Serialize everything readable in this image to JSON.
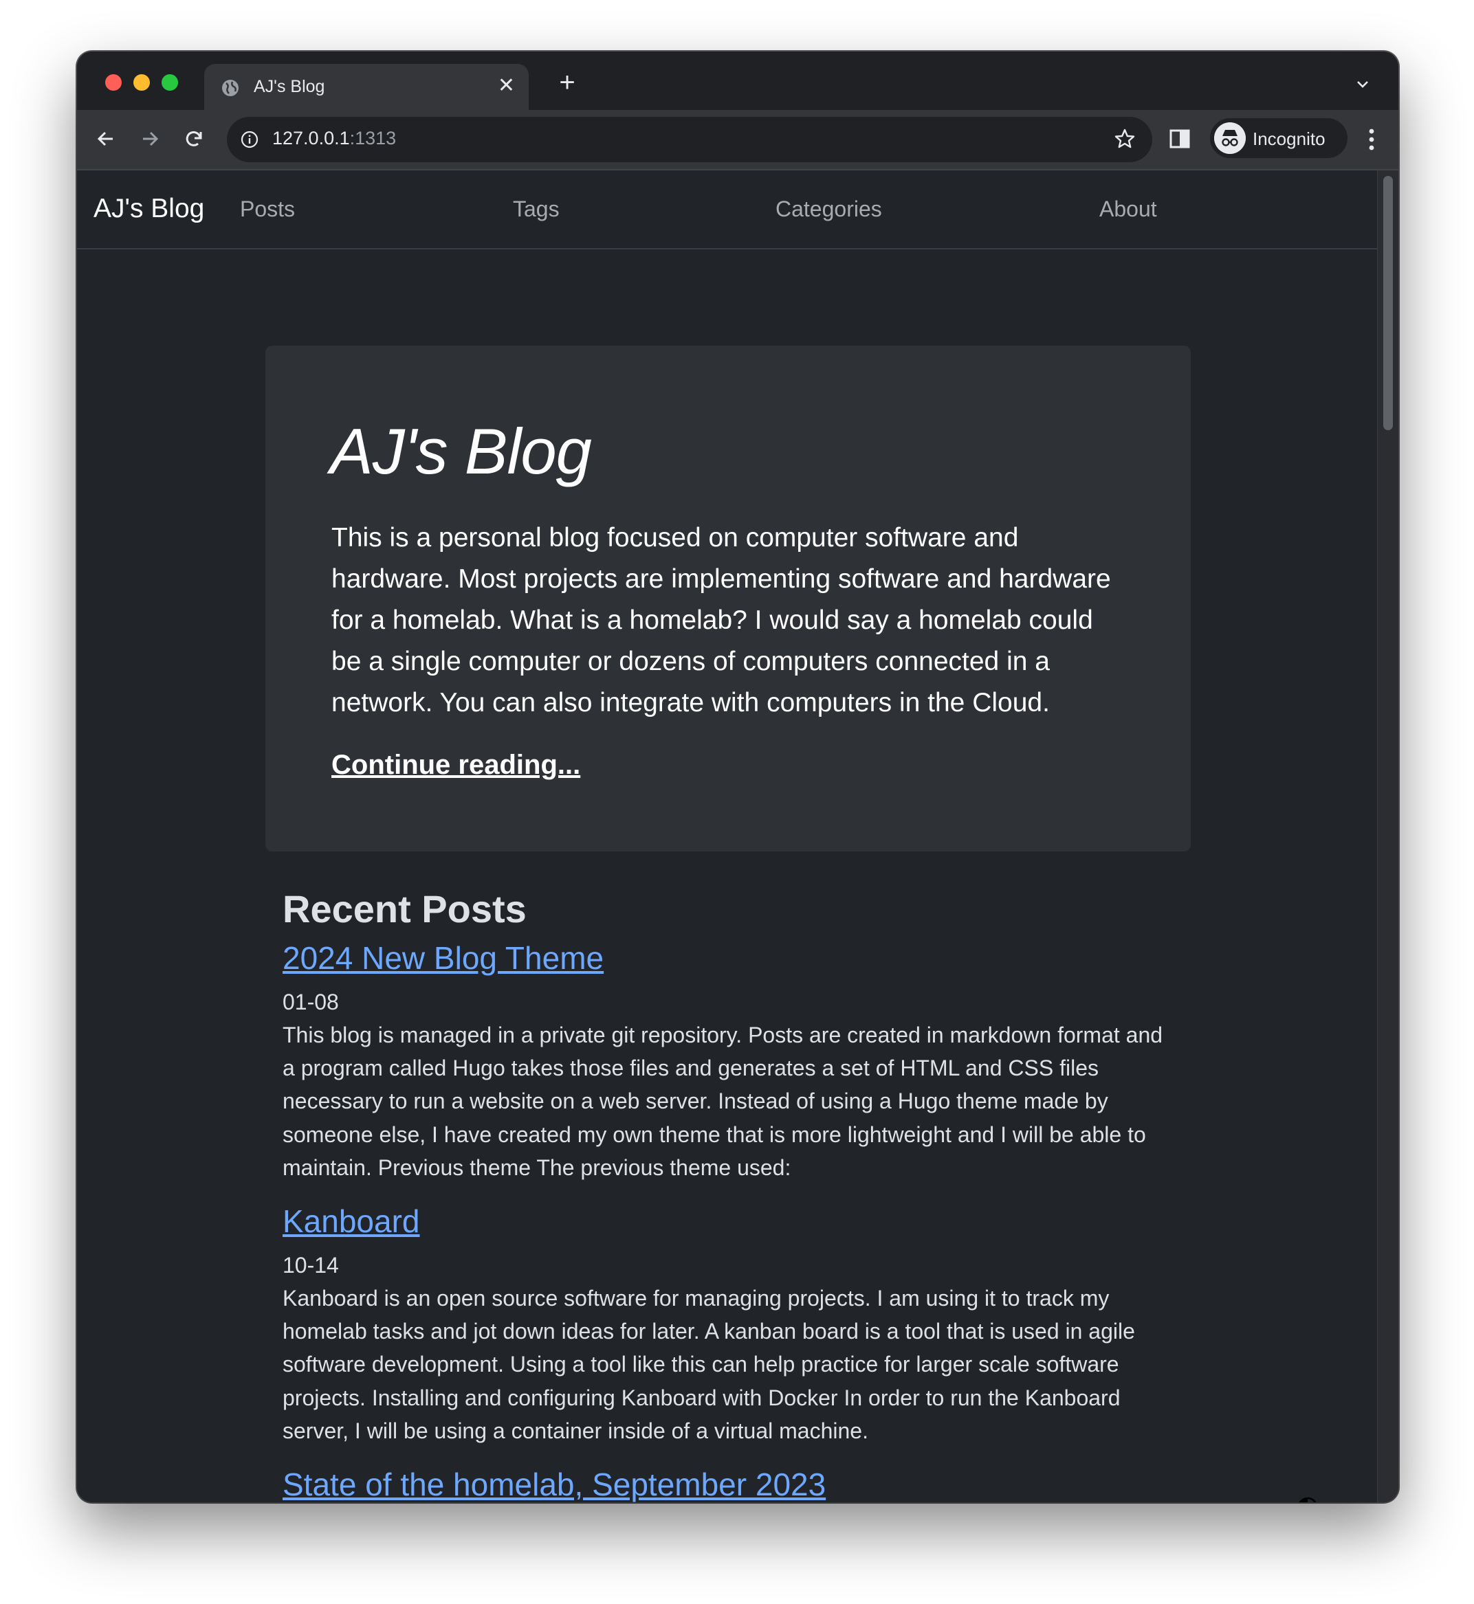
{
  "browser": {
    "tab_title": "AJ's Blog",
    "tab_close": "✕",
    "new_tab": "+",
    "url_host": "127.0.0.1",
    "url_port": ":1313",
    "incognito_label": "Incognito"
  },
  "navbar": {
    "brand": "AJ's Blog",
    "links": [
      "Posts",
      "Tags",
      "Categories",
      "About"
    ]
  },
  "jumbotron": {
    "title": "AJ's Blog",
    "lead": "This is a personal blog focused on computer software and hardware. Most projects are implementing software and hardware for a homelab. What is a homelab? I would say a homelab could be a single computer or dozens of computers connected in a network. You can also integrate with computers in the Cloud.",
    "link": "Continue reading..."
  },
  "recent_posts": {
    "heading": "Recent Posts",
    "posts": [
      {
        "title": "2024 New Blog Theme",
        "date": "01-08",
        "summary": "This blog is managed in a private git repository. Posts are created in markdown format and a program called Hugo takes those files and generates a set of HTML and CSS files necessary to run a website on a web server. Instead of using a Hugo theme made by someone else, I have created my own theme that is more lightweight and I will be able to maintain. Previous theme The previous theme used:"
      },
      {
        "title": "Kanboard",
        "date": "10-14",
        "summary": "Kanboard is an open source software for managing projects. I am using it to track my homelab tasks and jot down ideas for later. A kanban board is a tool that is used in agile software development. Using a tool like this can help practice for larger scale software projects. Installing and configuring Kanboard with Docker In order to run the Kanboard server, I will be using a container inside of a virtual machine."
      },
      {
        "title": "State of the homelab, September 2023",
        "date": "",
        "summary": ""
      }
    ]
  },
  "icons": {
    "tab": "globe-icon",
    "back": "arrow-left-icon",
    "forward": "arrow-right-icon",
    "reload": "reload-icon",
    "info": "info-icon",
    "bookmark": "star-icon",
    "side_panel": "side-panel-icon",
    "incognito": "incognito-icon",
    "menu": "kebab-menu-icon",
    "theme": "contrast-icon"
  },
  "colors": {
    "page_bg": "#212529",
    "jumbotron_bg": "#2e3136",
    "link": "#6ea8fe",
    "text": "#dee2e6"
  }
}
